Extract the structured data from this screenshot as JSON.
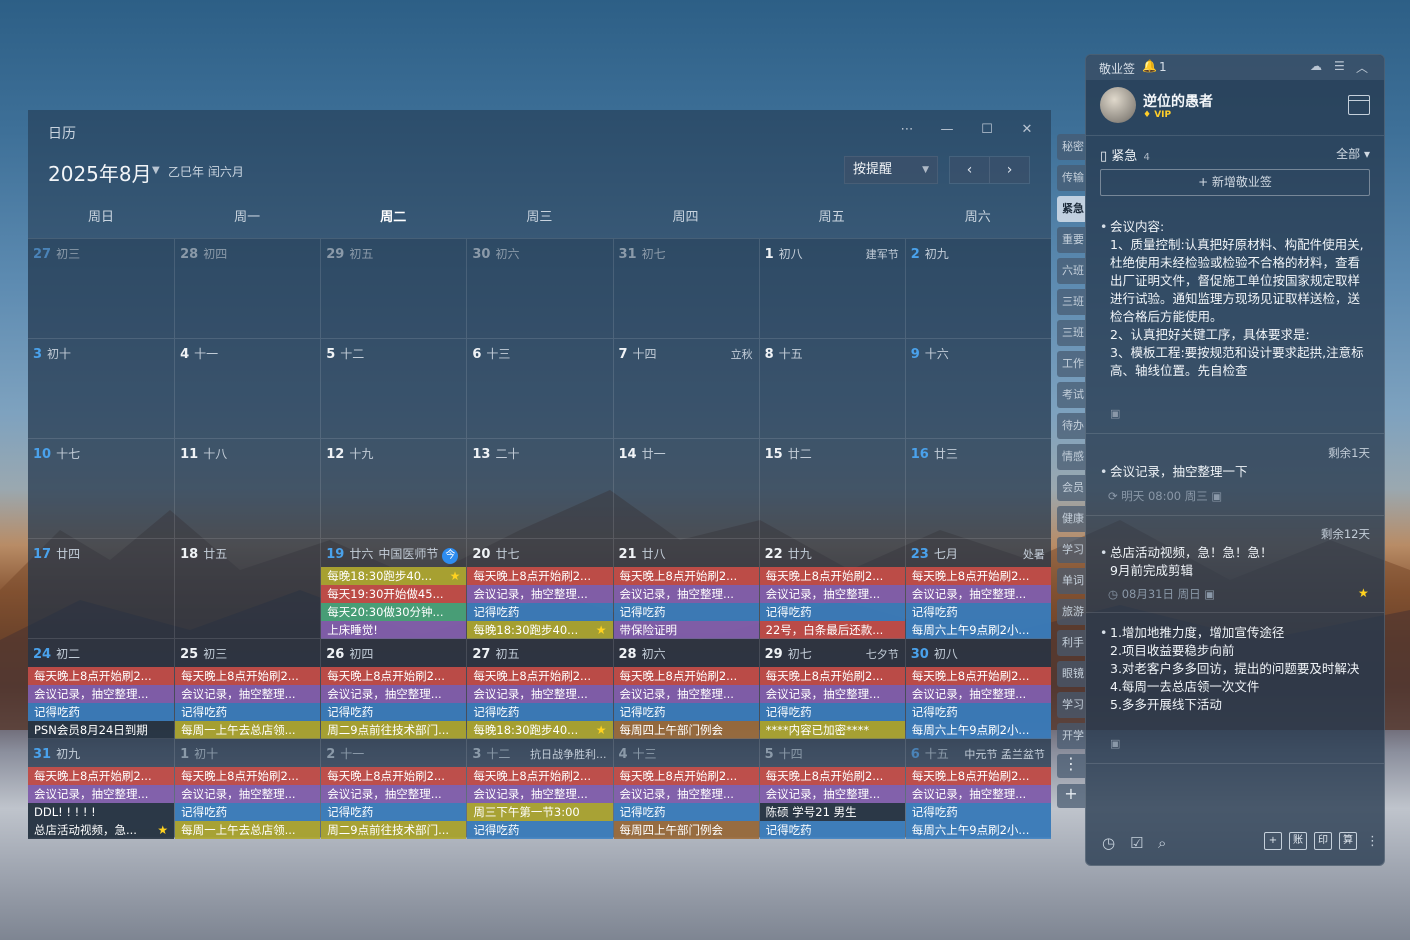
{
  "calendar": {
    "window_title": "日历",
    "month_title": "2025年8月",
    "lunar_title": "乙巳年 闰六月",
    "remind_mode": "按提醒",
    "weekdays": [
      "周日",
      "周一",
      "周二",
      "周三",
      "周四",
      "周五",
      "周六"
    ],
    "today_badge": "今",
    "weeks": [
      {
        "days": [
          {
            "d": "27",
            "l": "初三",
            "dim": true,
            "we": true,
            "fest": "",
            "ev": []
          },
          {
            "d": "28",
            "l": "初四",
            "dim": true,
            "fest": "",
            "ev": []
          },
          {
            "d": "29",
            "l": "初五",
            "dim": true,
            "fest": "",
            "ev": []
          },
          {
            "d": "30",
            "l": "初六",
            "dim": true,
            "fest": "",
            "ev": []
          },
          {
            "d": "31",
            "l": "初七",
            "dim": true,
            "fest": "",
            "ev": []
          },
          {
            "d": "1",
            "l": "初八",
            "fest": "建军节",
            "ev": []
          },
          {
            "d": "2",
            "l": "初九",
            "we": true,
            "fest": "",
            "ev": []
          }
        ]
      },
      {
        "days": [
          {
            "d": "3",
            "l": "初十",
            "we": true,
            "fest": "",
            "ev": []
          },
          {
            "d": "4",
            "l": "十一",
            "fest": "",
            "ev": []
          },
          {
            "d": "5",
            "l": "十二",
            "fest": "",
            "ev": []
          },
          {
            "d": "6",
            "l": "十三",
            "fest": "",
            "ev": []
          },
          {
            "d": "7",
            "l": "十四",
            "fest": "立秋",
            "ev": []
          },
          {
            "d": "8",
            "l": "十五",
            "fest": "",
            "ev": []
          },
          {
            "d": "9",
            "l": "十六",
            "we": true,
            "fest": "",
            "ev": []
          }
        ]
      },
      {
        "days": [
          {
            "d": "10",
            "l": "十七",
            "we": true,
            "fest": "",
            "ev": []
          },
          {
            "d": "11",
            "l": "十八",
            "fest": "",
            "ev": []
          },
          {
            "d": "12",
            "l": "十九",
            "fest": "",
            "ev": []
          },
          {
            "d": "13",
            "l": "二十",
            "fest": "",
            "ev": []
          },
          {
            "d": "14",
            "l": "廿一",
            "fest": "",
            "ev": []
          },
          {
            "d": "15",
            "l": "廿二",
            "fest": "",
            "ev": []
          },
          {
            "d": "16",
            "l": "廿三",
            "we": true,
            "fest": "",
            "ev": []
          }
        ]
      },
      {
        "days": [
          {
            "d": "17",
            "l": "廿四",
            "we": true,
            "fest": "",
            "ev": []
          },
          {
            "d": "18",
            "l": "廿五",
            "fest": "",
            "ev": []
          },
          {
            "d": "19",
            "l": "廿六",
            "we": true,
            "today": true,
            "fest": "中国医师节",
            "ev": [
              {
                "t": "每晚18:30跑步40...",
                "c": "yel",
                "star": true
              },
              {
                "t": "每天19:30开始做45...",
                "c": "red"
              },
              {
                "t": "每天20:30做30分钟...",
                "c": "grn"
              },
              {
                "t": "上床睡觉!",
                "c": "pur"
              }
            ]
          },
          {
            "d": "20",
            "l": "廿七",
            "fest": "",
            "ev": [
              {
                "t": "每天晚上8点开始刷2...",
                "c": "red"
              },
              {
                "t": "会议记录，抽空整理...",
                "c": "pur"
              },
              {
                "t": "记得吃药",
                "c": "blu"
              },
              {
                "t": "每晚18:30跑步40...",
                "c": "yel",
                "star": true
              }
            ]
          },
          {
            "d": "21",
            "l": "廿八",
            "fest": "",
            "ev": [
              {
                "t": "每天晚上8点开始刷2...",
                "c": "red"
              },
              {
                "t": "会议记录，抽空整理...",
                "c": "pur"
              },
              {
                "t": "记得吃药",
                "c": "blu"
              },
              {
                "t": "带保险证明",
                "c": "pur"
              }
            ]
          },
          {
            "d": "22",
            "l": "廿九",
            "fest": "",
            "ev": [
              {
                "t": "每天晚上8点开始刷2...",
                "c": "red"
              },
              {
                "t": "会议记录，抽空整理...",
                "c": "pur"
              },
              {
                "t": "记得吃药",
                "c": "blu"
              },
              {
                "t": "22号，白条最后还款...",
                "c": "red"
              }
            ]
          },
          {
            "d": "23",
            "l": "七月",
            "we": true,
            "fest": "处暑",
            "ev": [
              {
                "t": "每天晚上8点开始刷2...",
                "c": "red"
              },
              {
                "t": "会议记录，抽空整理...",
                "c": "pur"
              },
              {
                "t": "记得吃药",
                "c": "blu"
              },
              {
                "t": "每周六上午9点刷2小...",
                "c": "blu"
              }
            ]
          }
        ]
      },
      {
        "days": [
          {
            "d": "24",
            "l": "初二",
            "we": true,
            "fest": "",
            "ev": [
              {
                "t": "每天晚上8点开始刷2...",
                "c": "red"
              },
              {
                "t": "会议记录，抽空整理...",
                "c": "pur"
              },
              {
                "t": "记得吃药",
                "c": "blu"
              },
              {
                "t": "PSN会员8月24日到期",
                "c": "dk"
              }
            ]
          },
          {
            "d": "25",
            "l": "初三",
            "fest": "",
            "ev": [
              {
                "t": "每天晚上8点开始刷2...",
                "c": "red"
              },
              {
                "t": "会议记录，抽空整理...",
                "c": "pur"
              },
              {
                "t": "记得吃药",
                "c": "blu"
              },
              {
                "t": "每周一上午去总店领...",
                "c": "yel"
              }
            ]
          },
          {
            "d": "26",
            "l": "初四",
            "fest": "",
            "ev": [
              {
                "t": "每天晚上8点开始刷2...",
                "c": "red"
              },
              {
                "t": "会议记录，抽空整理...",
                "c": "pur"
              },
              {
                "t": "记得吃药",
                "c": "blu"
              },
              {
                "t": "周二9点前往技术部门...",
                "c": "yel"
              }
            ]
          },
          {
            "d": "27",
            "l": "初五",
            "fest": "",
            "ev": [
              {
                "t": "每天晚上8点开始刷2...",
                "c": "red"
              },
              {
                "t": "会议记录，抽空整理...",
                "c": "pur"
              },
              {
                "t": "记得吃药",
                "c": "blu"
              },
              {
                "t": "每晚18:30跑步40...",
                "c": "yel",
                "star": true
              }
            ]
          },
          {
            "d": "28",
            "l": "初六",
            "fest": "",
            "ev": [
              {
                "t": "每天晚上8点开始刷2...",
                "c": "red"
              },
              {
                "t": "会议记录，抽空整理...",
                "c": "pur"
              },
              {
                "t": "记得吃药",
                "c": "blu"
              },
              {
                "t": "每周四上午部门例会",
                "c": "brn"
              }
            ]
          },
          {
            "d": "29",
            "l": "初七",
            "fest": "七夕节",
            "ev": [
              {
                "t": "每天晚上8点开始刷2...",
                "c": "red"
              },
              {
                "t": "会议记录，抽空整理...",
                "c": "pur"
              },
              {
                "t": "记得吃药",
                "c": "blu"
              },
              {
                "t": "****内容已加密****",
                "c": "yel"
              }
            ]
          },
          {
            "d": "30",
            "l": "初八",
            "we": true,
            "fest": "",
            "ev": [
              {
                "t": "每天晚上8点开始刷2...",
                "c": "red"
              },
              {
                "t": "会议记录，抽空整理...",
                "c": "pur"
              },
              {
                "t": "记得吃药",
                "c": "blu"
              },
              {
                "t": "每周六上午9点刷2小...",
                "c": "blu"
              }
            ]
          }
        ]
      },
      {
        "days": [
          {
            "d": "31",
            "l": "初九",
            "we": true,
            "fest": "",
            "ev": [
              {
                "t": "每天晚上8点开始刷2...",
                "c": "red"
              },
              {
                "t": "会议记录，抽空整理...",
                "c": "pur"
              },
              {
                "t": "DDL! ! ! ! !",
                "c": "dk"
              },
              {
                "t": "总店活动视频，急...",
                "c": "dk",
                "star": true
              }
            ]
          },
          {
            "d": "1",
            "l": "初十",
            "dim": true,
            "fest": "",
            "ev": [
              {
                "t": "每天晚上8点开始刷2...",
                "c": "red"
              },
              {
                "t": "会议记录，抽空整理...",
                "c": "pur"
              },
              {
                "t": "记得吃药",
                "c": "blu"
              },
              {
                "t": "每周一上午去总店领...",
                "c": "yel"
              }
            ]
          },
          {
            "d": "2",
            "l": "十一",
            "dim": true,
            "fest": "",
            "ev": [
              {
                "t": "每天晚上8点开始刷2...",
                "c": "red"
              },
              {
                "t": "会议记录，抽空整理...",
                "c": "pur"
              },
              {
                "t": "记得吃药",
                "c": "blu"
              },
              {
                "t": "周二9点前往技术部门...",
                "c": "yel"
              }
            ]
          },
          {
            "d": "3",
            "l": "十二",
            "dim": true,
            "fest": "抗日战争胜利...",
            "ev": [
              {
                "t": "每天晚上8点开始刷2...",
                "c": "red"
              },
              {
                "t": "会议记录，抽空整理...",
                "c": "pur"
              },
              {
                "t": "周三下午第一节3:00",
                "c": "yel"
              },
              {
                "t": "记得吃药",
                "c": "blu"
              }
            ]
          },
          {
            "d": "4",
            "l": "十三",
            "dim": true,
            "fest": "",
            "ev": [
              {
                "t": "每天晚上8点开始刷2...",
                "c": "red"
              },
              {
                "t": "会议记录，抽空整理...",
                "c": "pur"
              },
              {
                "t": "记得吃药",
                "c": "blu"
              },
              {
                "t": "每周四上午部门例会",
                "c": "brn"
              }
            ]
          },
          {
            "d": "5",
            "l": "十四",
            "dim": true,
            "fest": "",
            "ev": [
              {
                "t": "每天晚上8点开始刷2...",
                "c": "red"
              },
              {
                "t": "会议记录，抽空整理...",
                "c": "pur"
              },
              {
                "t": "陈硕 学号21 男生",
                "c": "dk"
              },
              {
                "t": "记得吃药",
                "c": "blu"
              }
            ]
          },
          {
            "d": "6",
            "l": "十五",
            "dim": true,
            "we": true,
            "fest": "中元节 孟兰盆节",
            "ev": [
              {
                "t": "每天晚上8点开始刷2...",
                "c": "red"
              },
              {
                "t": "会议记录，抽空整理...",
                "c": "pur"
              },
              {
                "t": "记得吃药",
                "c": "blu"
              },
              {
                "t": "每周六上午9点刷2小...",
                "c": "blu"
              }
            ]
          }
        ]
      }
    ]
  },
  "tabs": [
    "秘密",
    "传输",
    "紧急",
    "重要",
    "六班",
    "三班",
    "三班",
    "工作",
    "考试",
    "待办",
    "情感",
    "会员",
    "健康",
    "学习",
    "单词",
    "旅游",
    "利手",
    "眼镜",
    "学习",
    "开学"
  ],
  "selected_tab": "紧急",
  "sticky": {
    "title": "敬业签",
    "bell_count": "1",
    "username": "逆位的愚者",
    "vip": "VIP",
    "category": "紧急",
    "category_count": "4",
    "filter": "全部",
    "new_button": "+ 新增敬业签",
    "notes": [
      {
        "text": "会议内容:\n1、质量控制:认真把好原材料、构配件使用关,杜绝使用未经检验或检验不合格的材料，查看出厂证明文件，督促施工单位按国家规定取样进行试验。通知监理方现场见证取样送检，送检合格后方能使用。\n2、认真把好关键工序，具体要求是:\n3、模板工程:要按规范和设计要求起拱,注意标高、轴线位置。先自检查"
      },
      {
        "remain": "剩余1天",
        "text": "会议记录，抽空整理一下",
        "meta": "明天 08:00 周三"
      },
      {
        "remain": "剩余12天",
        "text": "总店活动视频，急！急！急！\n9月前完成剪辑",
        "meta": "08月31日 周日"
      },
      {
        "text": "1.增加地推力度，增加宣传途径\n2.项目收益要稳步向前\n3.对老客户多多回访，提出的问题要及时解决\n4.每周一去总店领一次文件\n5.多多开展线下活动"
      }
    ],
    "footer_buttons": [
      "+",
      "账",
      "印",
      "算"
    ]
  }
}
